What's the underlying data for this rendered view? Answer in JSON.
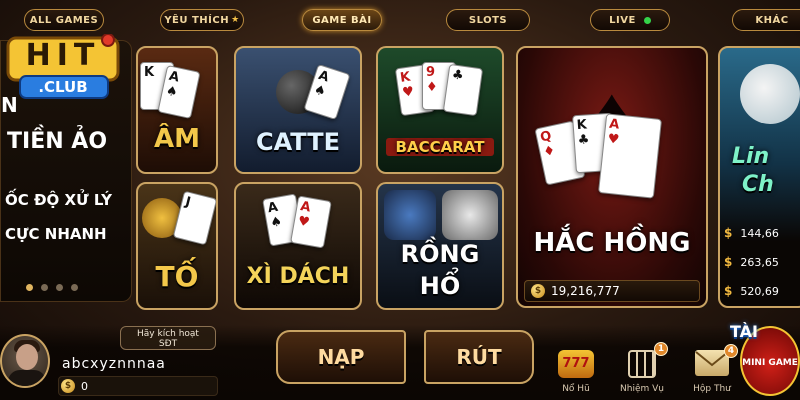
{
  "tabs": [
    {
      "id": "all",
      "label": "ALL GAMES"
    },
    {
      "id": "favorite",
      "label": "YÊU THÍCH"
    },
    {
      "id": "card",
      "label": "GAME BÀI"
    },
    {
      "id": "slots",
      "label": "SLOTS"
    },
    {
      "id": "live",
      "label": "LIVE"
    },
    {
      "id": "other",
      "label": "KHÁC"
    }
  ],
  "active_tab": "card",
  "promo": {
    "logo_top": "HIT",
    "logo_bottom": ".CLUB",
    "line1": "N",
    "line2": "TIỀN ẢO",
    "line3": "ỐC ĐỘ XỬ LÝ",
    "line4": "CỰC NHANH"
  },
  "games": {
    "tien_len": "ÂM",
    "catte": "CATTE",
    "baccarat": "BACCARAT",
    "hac_hong": "HẮC HỒNG",
    "hac_hong_jackpot": "19,216,777",
    "mau_binh": "TỐ",
    "xi_dach": "XÌ DÁCH",
    "rong_ho_line1": "RỒNG",
    "rong_ho_line2": "HỔ",
    "lucky_line1": "Lin",
    "lucky_line2": "Ch"
  },
  "jackpots": [
    "144,66",
    "263,65",
    "520,69"
  ],
  "currency_symbol": "$",
  "user": {
    "activate_line1": "Hãy kích hoạt",
    "activate_line2": "SĐT",
    "username": "abcxyznnnaa",
    "balance": "0"
  },
  "actions": {
    "deposit": "NẠP",
    "withdraw": "RÚT"
  },
  "bottom_icons": {
    "jackpot_label": "Nổ Hũ",
    "missions_label": "Nhiệm Vụ",
    "missions_badge": "1",
    "mail_label": "Hộp Thư",
    "mail_badge": "4",
    "mini_game_top": "TÀI",
    "mini_game_label": "MINI GAME"
  },
  "colors": {
    "gold": "#c9a363",
    "live_dot": "#34d34a",
    "badge": "#e0872a"
  }
}
